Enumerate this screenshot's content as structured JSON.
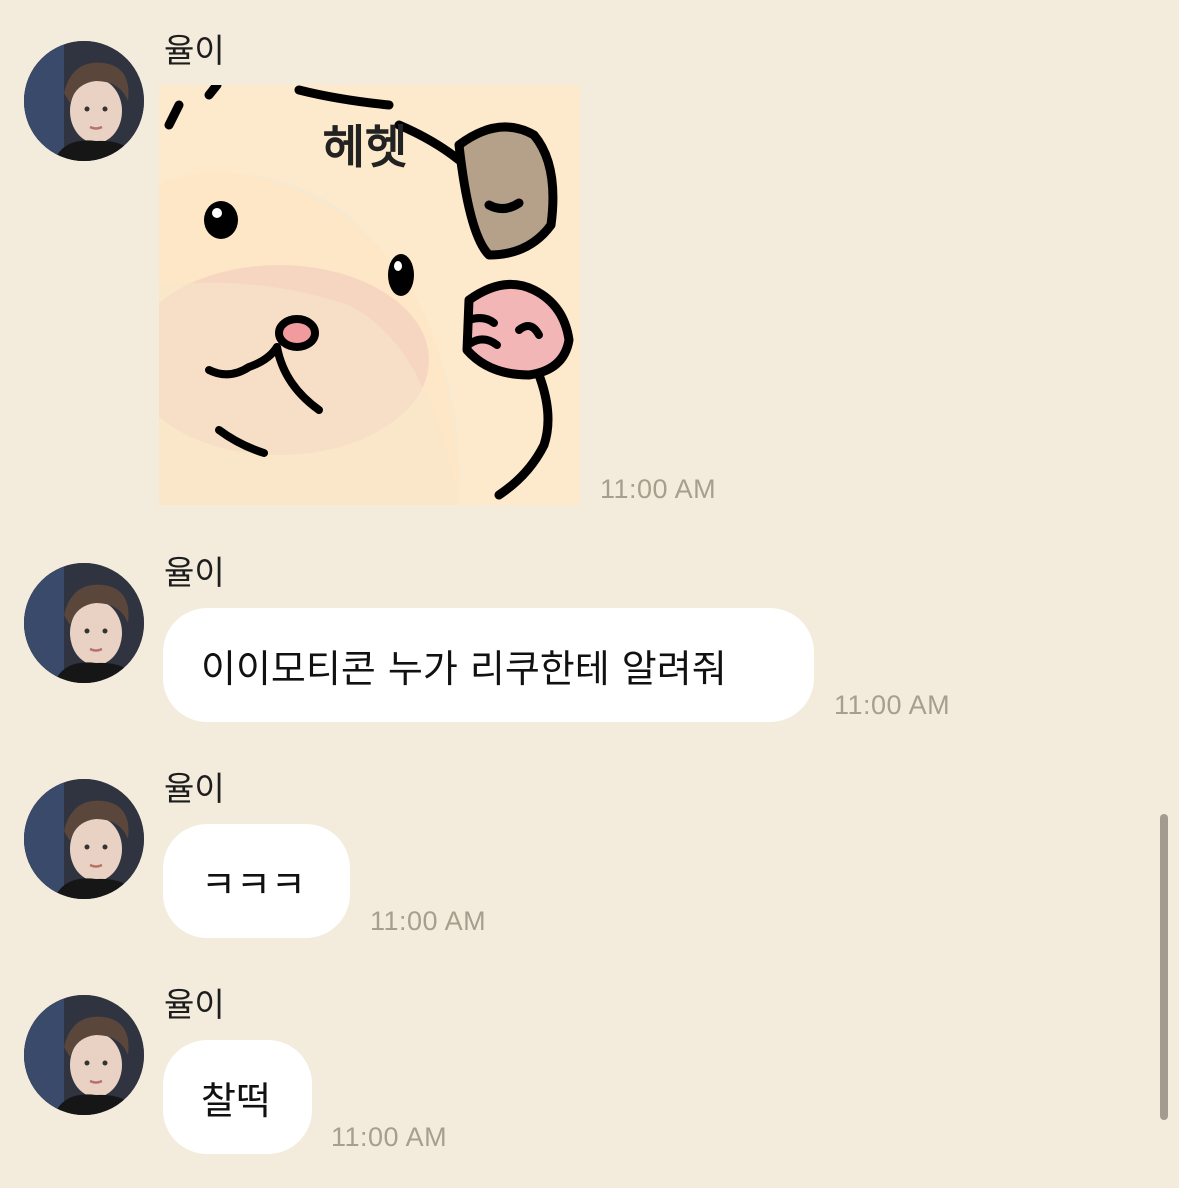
{
  "messages": [
    {
      "sender": "율이",
      "type": "sticker",
      "sticker_text": "헤헷",
      "time": "11:00 AM"
    },
    {
      "sender": "율이",
      "type": "text",
      "text": "이이모티콘 누가 리쿠한테 알려줘",
      "time": "11:00 AM"
    },
    {
      "sender": "율이",
      "type": "text",
      "text": "ㅋㅋㅋ",
      "time": "11:00 AM"
    },
    {
      "sender": "율이",
      "type": "text",
      "text": "찰떡",
      "time": "11:00 AM"
    }
  ],
  "colors": {
    "background": "#f3ebdb",
    "bubble": "#ffffff",
    "timestamp": "#a79e8e",
    "scrollbar": "#a49b8f"
  },
  "icons": {
    "avatar": "profile-photo",
    "sticker": "hamster-sticker"
  }
}
